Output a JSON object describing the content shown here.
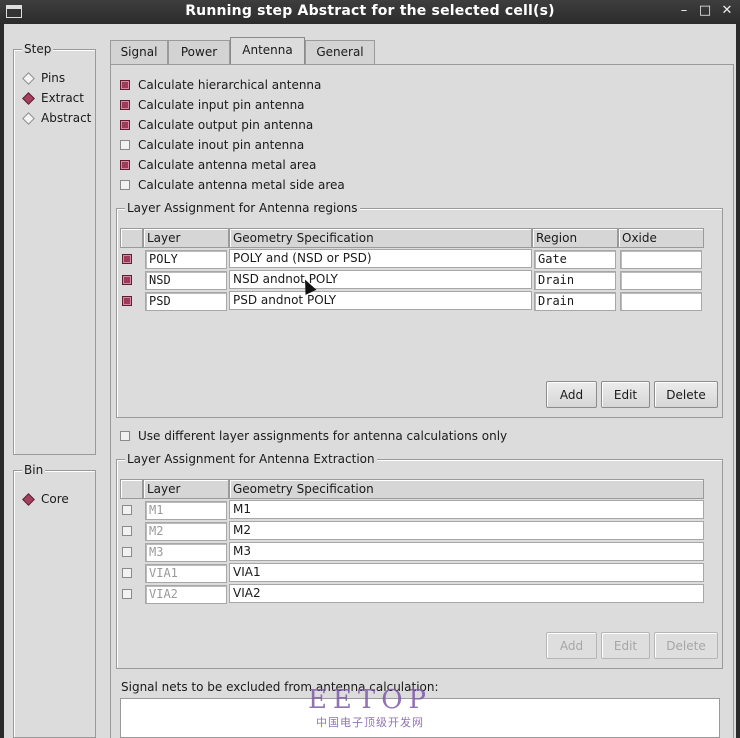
{
  "window": {
    "title": "Running step Abstract for the selected cell(s)",
    "min": "–",
    "max": "□",
    "close": "✕"
  },
  "step": {
    "label": "Step",
    "options": [
      {
        "label": "Pins",
        "selected": false
      },
      {
        "label": "Extract",
        "selected": true
      },
      {
        "label": "Abstract",
        "selected": false
      }
    ]
  },
  "bin": {
    "label": "Bin",
    "options": [
      {
        "label": "Core",
        "selected": true
      }
    ]
  },
  "tabs": [
    {
      "label": "Signal",
      "active": false
    },
    {
      "label": "Power",
      "active": false
    },
    {
      "label": "Antenna",
      "active": true
    },
    {
      "label": "General",
      "active": false
    }
  ],
  "antenna_options": [
    {
      "label": "Calculate hierarchical antenna",
      "checked": true
    },
    {
      "label": "Calculate input pin antenna",
      "checked": true
    },
    {
      "label": "Calculate output pin antenna",
      "checked": true
    },
    {
      "label": "Calculate inout pin antenna",
      "checked": false
    },
    {
      "label": "Calculate antenna metal area",
      "checked": true
    },
    {
      "label": "Calculate antenna metal side area",
      "checked": false
    }
  ],
  "regions": {
    "label": "Layer Assignment for Antenna regions",
    "columns": [
      "Layer",
      "Geometry Specification",
      "Region",
      "Oxide"
    ],
    "rows": [
      {
        "checked": true,
        "layer": "POLY",
        "spec": "POLY and (NSD or PSD)",
        "region": "Gate",
        "oxide": ""
      },
      {
        "checked": true,
        "layer": "NSD",
        "spec": "NSD andnot POLY",
        "region": "Drain",
        "oxide": ""
      },
      {
        "checked": true,
        "layer": "PSD",
        "spec": "PSD andnot POLY",
        "region": "Drain",
        "oxide": ""
      }
    ],
    "buttons": {
      "add": "Add",
      "edit": "Edit",
      "delete": "Delete"
    }
  },
  "use_different": {
    "label": "Use different layer assignments for antenna calculations only",
    "checked": false
  },
  "extraction": {
    "label": "Layer Assignment for Antenna Extraction",
    "columns": [
      "Layer",
      "Geometry Specification"
    ],
    "rows": [
      {
        "layer": "M1",
        "spec": "M1"
      },
      {
        "layer": "M2",
        "spec": "M2"
      },
      {
        "layer": "M3",
        "spec": "M3"
      },
      {
        "layer": "VIA1",
        "spec": "VIA1"
      },
      {
        "layer": "VIA2",
        "spec": "VIA2"
      }
    ],
    "buttons": {
      "add": "Add",
      "edit": "Edit",
      "delete": "Delete"
    }
  },
  "excluded_nets": {
    "label": "Signal nets to be excluded from antenna calculation:"
  },
  "watermark": {
    "brand": "EETOP",
    "tagline": "中国电子顶级开发网"
  }
}
